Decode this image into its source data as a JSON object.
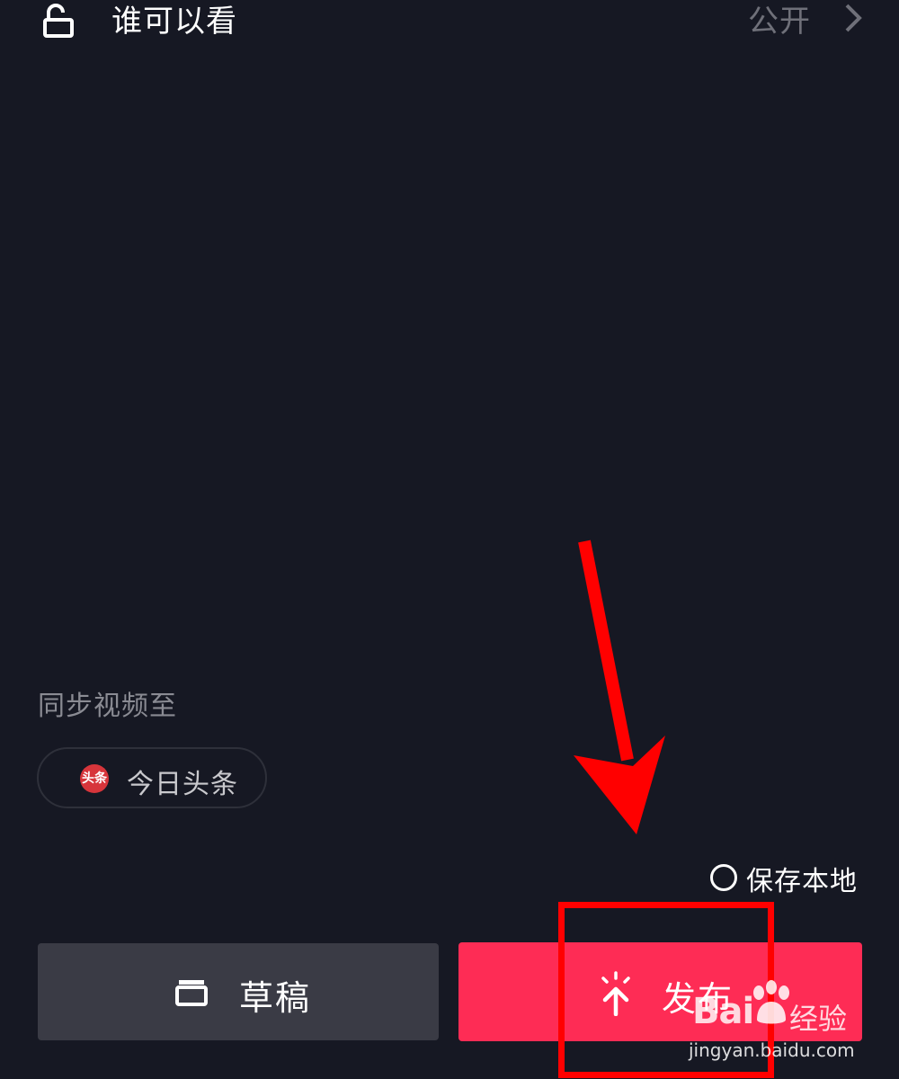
{
  "visibility": {
    "label": "谁可以看",
    "value": "公开",
    "icon": "lock-open-icon",
    "chevron_icon": "chevron-right-icon"
  },
  "sync": {
    "title": "同步视频至",
    "platform": {
      "label": "今日头条",
      "logo_text": "头条",
      "logo_color": "#d7353b"
    }
  },
  "save_local": {
    "label": "保存本地",
    "checked": false
  },
  "actions": {
    "draft": {
      "label": "草稿",
      "icon": "draft-box-icon",
      "color": "#3a3b45"
    },
    "publish": {
      "label": "发布",
      "icon": "publish-arrow-icon",
      "color": "#fe2c55"
    }
  },
  "annotation": {
    "color": "#ff0000"
  },
  "watermark": {
    "brand": "Bai",
    "brand_suffix": "经验",
    "url": "jingyan.baidu.com"
  },
  "colors": {
    "background": "#161823",
    "muted_text": "#8a8b93"
  }
}
